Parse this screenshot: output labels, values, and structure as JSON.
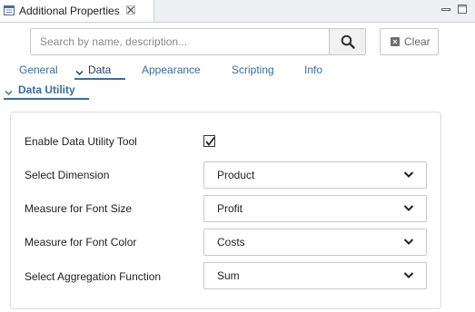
{
  "window": {
    "tab_title": "Additional Properties",
    "tab_icon": "properties-icon",
    "close_icon": "close-icon",
    "minimize_icon": "minimize-icon",
    "maximize_icon": "maximize-icon"
  },
  "search": {
    "placeholder": "Search by name, description...",
    "value": "",
    "button_icon": "search-icon",
    "clear_label": "Clear",
    "clear_icon": "clear-icon"
  },
  "tabs": [
    {
      "label": "General",
      "active": false
    },
    {
      "label": "Data",
      "active": true
    },
    {
      "label": "Appearance",
      "active": false
    },
    {
      "label": "Scripting",
      "active": false
    },
    {
      "label": "Info",
      "active": false
    }
  ],
  "section": {
    "title": "Data Utility",
    "expanded": true
  },
  "fields": {
    "enable": {
      "label": "Enable Data Utility Tool",
      "checked": true
    },
    "dimension": {
      "label": "Select Dimension",
      "value": "Product"
    },
    "font_size": {
      "label": "Measure for Font Size",
      "value": "Profit"
    },
    "font_color": {
      "label": "Measure for Font Color",
      "value": "Costs"
    },
    "aggregation": {
      "label": "Select Aggregation Function",
      "value": "Sum"
    }
  },
  "colors": {
    "accent": "#3a6e9c",
    "active_tab_text": "#1f3f5e",
    "titlebar_bg": "#eef0f3",
    "border": "#c9c9c9"
  }
}
